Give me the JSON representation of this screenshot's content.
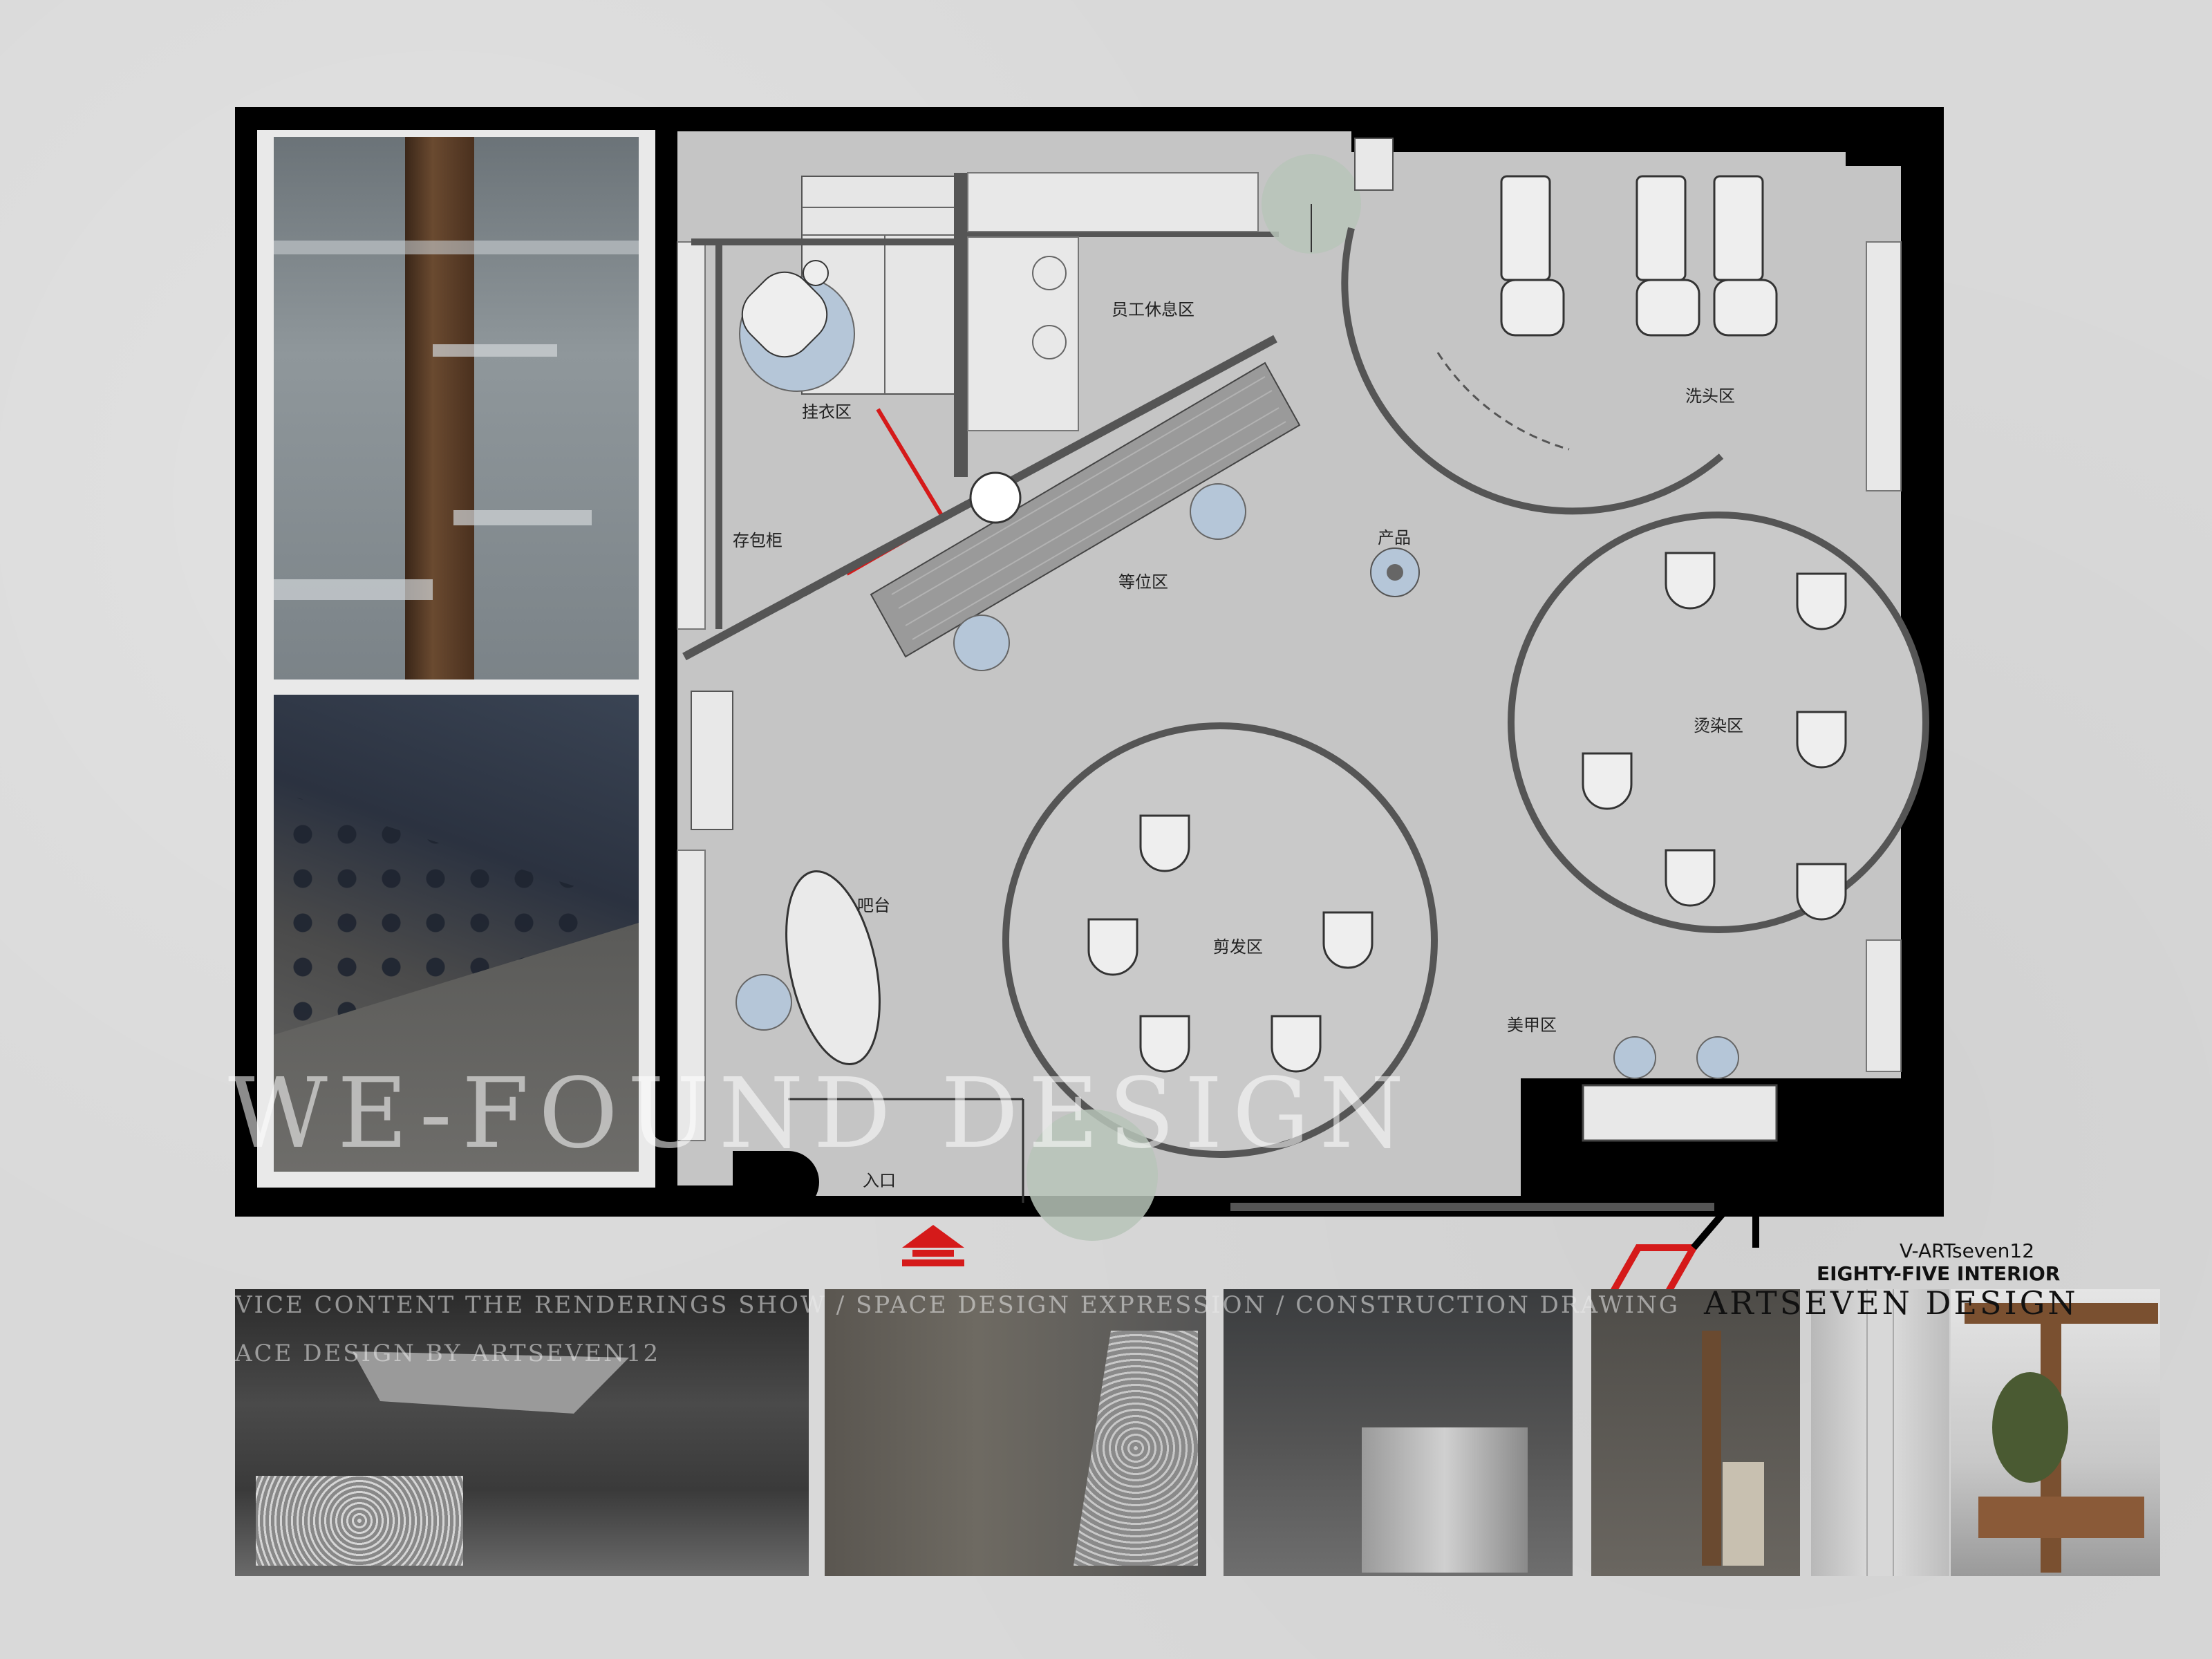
{
  "zones": {
    "staff_lounge": "员工休息区",
    "cloak": "挂衣区",
    "lockers": "存包柜",
    "waiting": "等位区",
    "product": "产品",
    "wash": "洗头区",
    "dye": "烫染区",
    "bar": "吧台",
    "cut": "剪发区",
    "nail": "美甲区",
    "entrance": "入口"
  },
  "watermark": "WE-FOUND DESIGN",
  "strip_captions": {
    "line1": "VICE CONTENT THE RENDERINGS SHOW / SPACE DESIGN EXPRESSION / CONSTRUCTION DRAWING",
    "line2": "ACE DESIGN BY ARTSEVEN12"
  },
  "logo": {
    "name": "V-ARTseven12",
    "subtitle": "EIGHTY-FIVE INTERIOR",
    "brand": "ARTSEVEN DESIGN"
  },
  "colors": {
    "wall": "#000000",
    "floor": "#c4c4c4",
    "accent_red": "#d51a1a",
    "stool_blue": "#b5c6d8",
    "door_green": "#b7c4b8"
  }
}
